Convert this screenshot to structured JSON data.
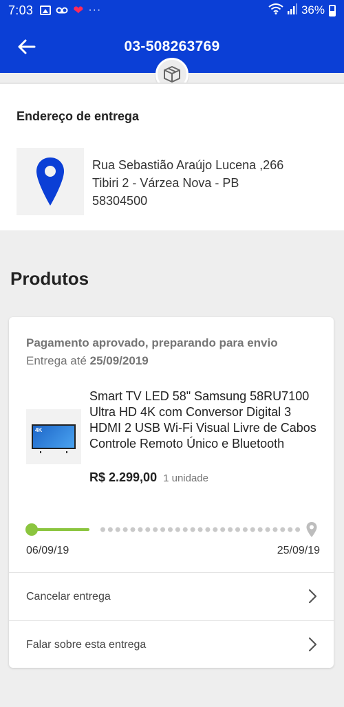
{
  "status_bar": {
    "time": "7:03",
    "icons": [
      "image-icon",
      "voicemail-icon",
      "heart-icon",
      "more-notifications-icon"
    ],
    "more": "···",
    "battery": "36%"
  },
  "header": {
    "title": "03-508263769",
    "back_icon": "arrow-left-icon",
    "badge_icon": "package-box-icon",
    "color": "#0b3fd6"
  },
  "address": {
    "heading": "Endereço de entrega",
    "icon": "map-pin-icon",
    "line1": "Rua Sebastião Araújo Lucena ,266",
    "line2": "Tibiri 2 - Várzea Nova - PB",
    "line3": "58304500"
  },
  "products": {
    "title": "Produtos",
    "order": {
      "status": "Pagamento aprovado, preparando para envio",
      "delivery_prefix": "Entrega até",
      "delivery_date": "25/09/2019",
      "product": {
        "image_icon": "tv-thumbnail",
        "name": "Smart TV LED 58\" Samsung 58RU7100 Ultra HD 4K com Conversor Digital 3 HDMI 2 USB Wi-Fi Visual Livre de Cabos Controle Remoto Único e Bluetooth",
        "price": "R$ 2.299,00",
        "quantity": "1 unidade",
        "thumb_text": "4K"
      },
      "tracking": {
        "start_date": "06/09/19",
        "end_date": "25/09/19",
        "progress": 0.18,
        "accent_color": "#8bc53f"
      },
      "actions": [
        {
          "label": "Cancelar entrega",
          "icon": "chevron-right-icon"
        },
        {
          "label": "Falar sobre esta entrega",
          "icon": "chevron-right-icon"
        }
      ]
    }
  }
}
